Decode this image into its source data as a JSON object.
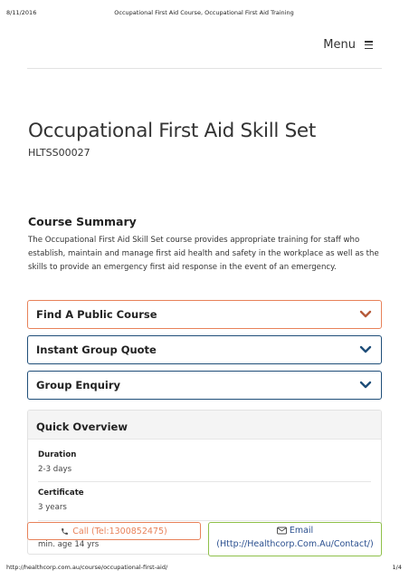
{
  "print_header": {
    "date": "8/11/2016",
    "doc_title": "Occupational First Aid Course, Occupational First Aid Training"
  },
  "nav": {
    "menu_label": "Menu",
    "menu_icon": "hamburger-icon"
  },
  "course": {
    "title": "Occupational First Aid Skill Set",
    "code": "HLTSS00027"
  },
  "summary": {
    "heading": "Course Summary",
    "text": "The Occupational First Aid Skill Set course provides appropriate training for staff who establish, maintain and manage first aid health and safety in the workplace as well as the skills to provide an emergency first aid response in the event of an emergency."
  },
  "accordions": [
    {
      "label": "Find A Public Course",
      "icon": "chevron-down-icon",
      "chevron_color": "#b65a3a"
    },
    {
      "label": "Instant Group Quote",
      "icon": "chevron-down-icon",
      "chevron_color": "#1f4e79"
    },
    {
      "label": "Group Enquiry",
      "icon": "chevron-down-icon",
      "chevron_color": "#1f4e79"
    }
  ],
  "overview": {
    "heading": "Quick Overview",
    "items": [
      {
        "label": "Duration",
        "value": "2-3 days"
      },
      {
        "label": "Certificate",
        "value": "3 years"
      },
      {
        "label": "",
        "value": "min. age 14 yrs"
      }
    ]
  },
  "contact": {
    "call_label": "Call (Tel:1300852475)",
    "call_icon": "phone-icon",
    "email_label": "Email",
    "email_link": "(Http://Healthcorp.Com.Au/Contact/)",
    "email_icon": "envelope-icon"
  },
  "print_footer": {
    "url": "http://healthcorp.com.au/course/occupational-first-aid/",
    "page": "1/4"
  },
  "colors": {
    "accent_orange": "#e8825a",
    "accent_navy": "#1f4e79",
    "accent_green": "#8fc04a",
    "link_blue": "#2a4f8f"
  }
}
